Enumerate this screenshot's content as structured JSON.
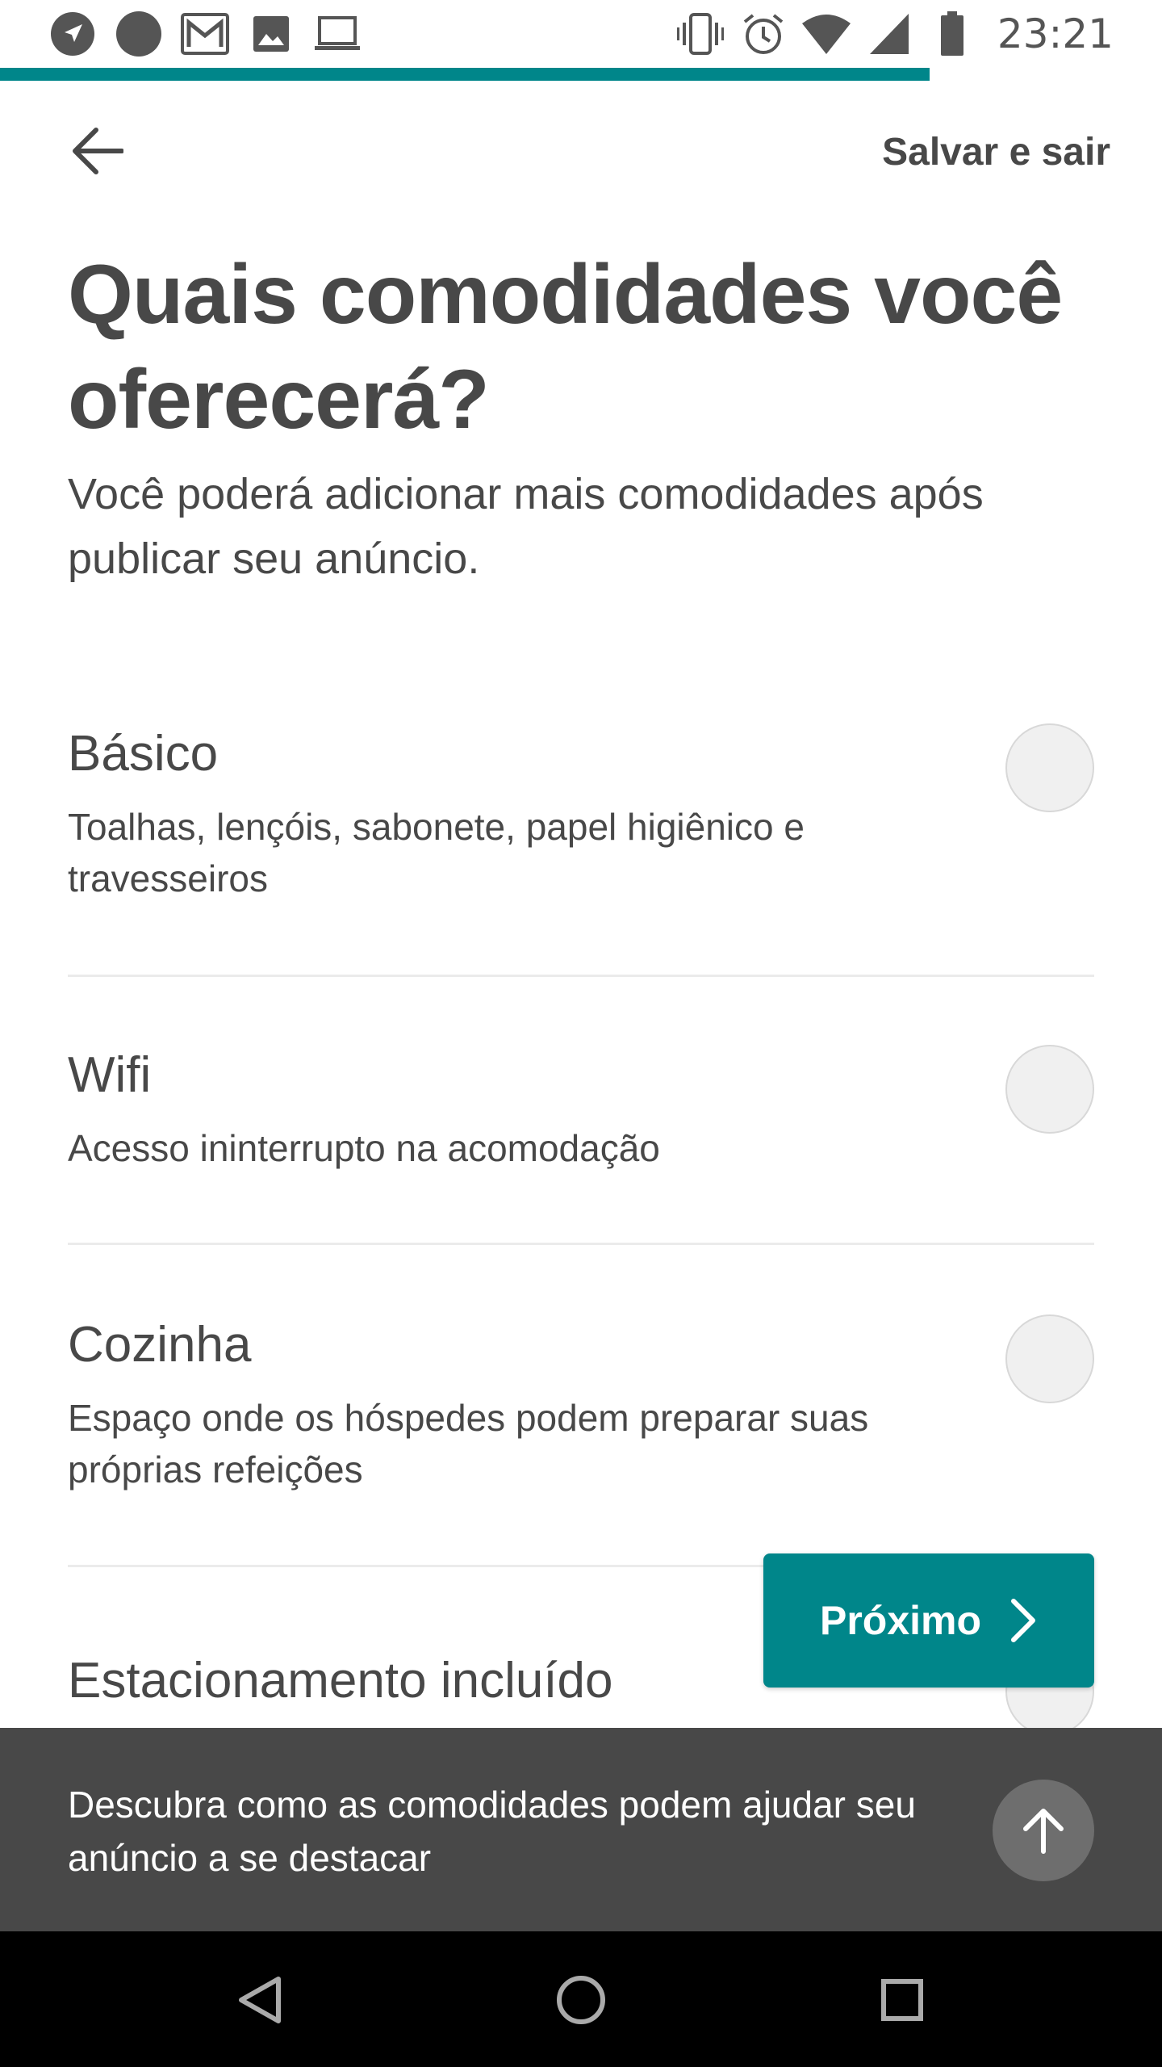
{
  "status_bar": {
    "time": "23:21",
    "left_icons": [
      "navigation-icon",
      "circle-notification-icon",
      "gmail-icon",
      "image-icon",
      "laptop-icon"
    ],
    "right_icons": [
      "vibrate-icon",
      "alarm-icon",
      "wifi-icon",
      "signal-icon",
      "battery-icon"
    ]
  },
  "progress": {
    "value": 0.8,
    "color": "#00868a"
  },
  "header": {
    "save_exit_label": "Salvar e sair"
  },
  "page": {
    "title_line1": "Quais comodidades você",
    "title_line2": "oferecerá?",
    "subtitle": "Você poderá adicionar mais comodidades após publicar seu anúncio."
  },
  "amenities": [
    {
      "title": "Básico",
      "description": "Toalhas, lençóis, sabonete, papel higiênico e travesseiros",
      "checked": false
    },
    {
      "title": "Wifi",
      "description": "Acesso ininterrupto na acomodação",
      "checked": false
    },
    {
      "title": "Cozinha",
      "description": "Espaço onde os hóspedes podem preparar suas próprias refeições",
      "checked": false
    },
    {
      "title": "Estacionamento incluído",
      "description": "",
      "checked": false
    }
  ],
  "next_button": {
    "label": "Próximo"
  },
  "banner": {
    "text": "Descubra como as comodidades podem ajudar seu anúncio a se destacar"
  },
  "colors": {
    "accent": "#00868a",
    "text": "#484848",
    "banner_bg": "#484848"
  }
}
